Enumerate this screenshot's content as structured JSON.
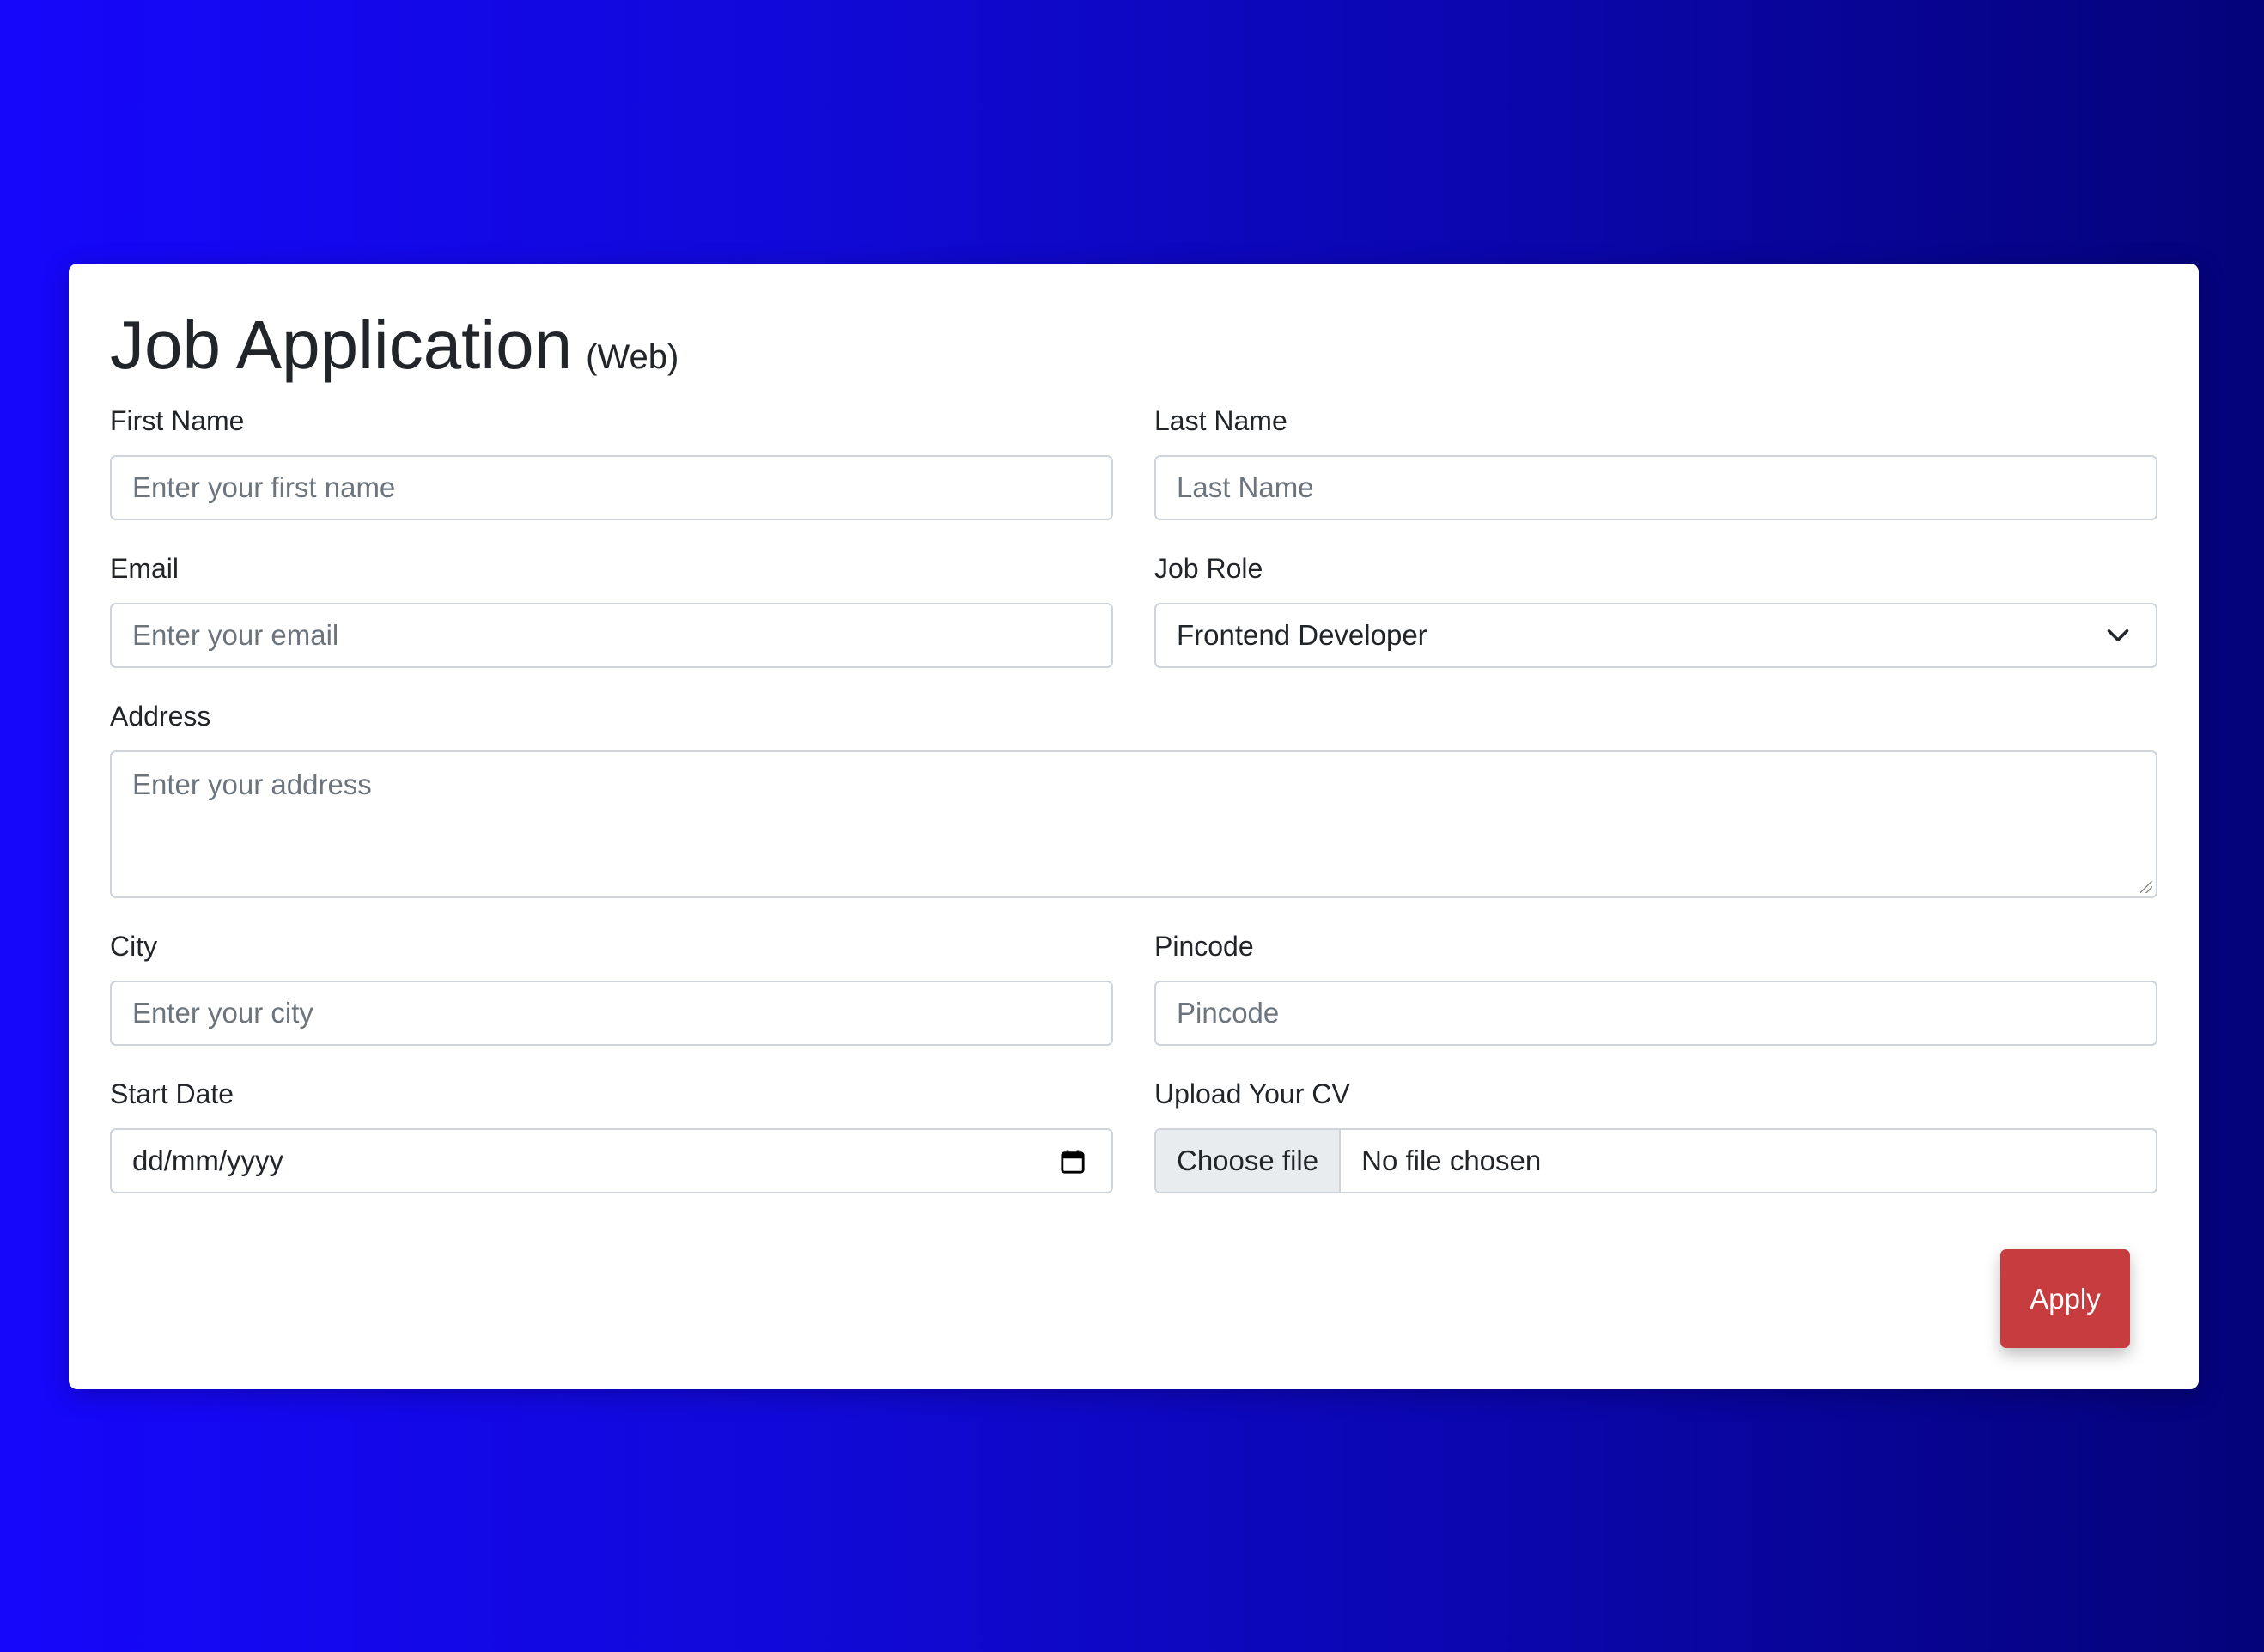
{
  "header": {
    "title": "Job Application",
    "subtitle": "(Web)"
  },
  "form": {
    "first_name": {
      "label": "First Name",
      "placeholder": "Enter your first name",
      "value": ""
    },
    "last_name": {
      "label": "Last Name",
      "placeholder": "Last Name",
      "value": ""
    },
    "email": {
      "label": "Email",
      "placeholder": "Enter your email",
      "value": ""
    },
    "job_role": {
      "label": "Job Role",
      "selected": "Frontend Developer"
    },
    "address": {
      "label": "Address",
      "placeholder": "Enter your address",
      "value": ""
    },
    "city": {
      "label": "City",
      "placeholder": "Enter your city",
      "value": ""
    },
    "pincode": {
      "label": "Pincode",
      "placeholder": "Pincode",
      "value": ""
    },
    "start_date": {
      "label": "Start Date",
      "value": "dd/mm/yyyy"
    },
    "cv_upload": {
      "label": "Upload Your CV",
      "button_label": "Choose file",
      "status": "No file chosen"
    },
    "submit_label": "Apply"
  },
  "colors": {
    "background_gradient_start": "#1607fb",
    "background_gradient_end": "#05037a",
    "card": "#ffffff",
    "apply_button": "#c63c3f"
  },
  "icons": {
    "job_role": "chevron-down-icon",
    "start_date": "calendar-icon"
  }
}
